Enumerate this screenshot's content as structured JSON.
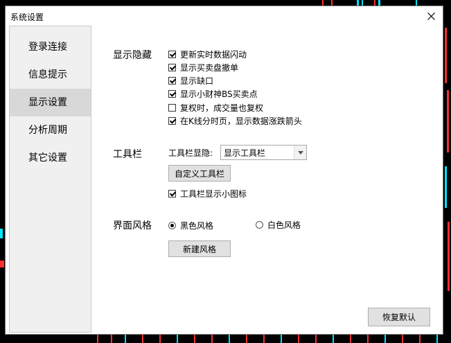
{
  "window": {
    "title": "系统设置"
  },
  "sidebar": {
    "items": [
      {
        "label": "登录连接"
      },
      {
        "label": "信息提示"
      },
      {
        "label": "显示设置"
      },
      {
        "label": "分析周期"
      },
      {
        "label": "其它设置"
      }
    ],
    "active": "显示设置"
  },
  "display_hide": {
    "label": "显示隐藏",
    "options": [
      {
        "label": "更新实时数据闪动",
        "checked": true
      },
      {
        "label": "显示买卖盘撤单",
        "checked": true
      },
      {
        "label": "显示缺口",
        "checked": true
      },
      {
        "label": "显示小财神BS买卖点",
        "checked": true
      },
      {
        "label": "复权时，成交量也复权",
        "checked": false
      },
      {
        "label": "在K线分时页，显示数据涨跌箭头",
        "checked": true
      }
    ]
  },
  "toolbar": {
    "label": "工具栏",
    "display_label": "工具栏显隐:",
    "display_value": "显示工具栏",
    "customize_button": "自定义工具栏",
    "small_icons": {
      "label": "工具栏显示小图标",
      "checked": true
    }
  },
  "style": {
    "label": "界面风格",
    "options": [
      {
        "label": "黑色风格",
        "checked": true
      },
      {
        "label": "白色风格",
        "checked": false
      }
    ],
    "new_button": "新建风格"
  },
  "footer": {
    "restore_button": "恢复默认"
  },
  "colors": {
    "background": "#000000",
    "chart_red": "#ff3030",
    "chart_cyan": "#00e5ff",
    "dialog": "#ffffff",
    "sidebar_bg": "#f0f0f0",
    "sidebar_active": "#d8d8d8"
  }
}
